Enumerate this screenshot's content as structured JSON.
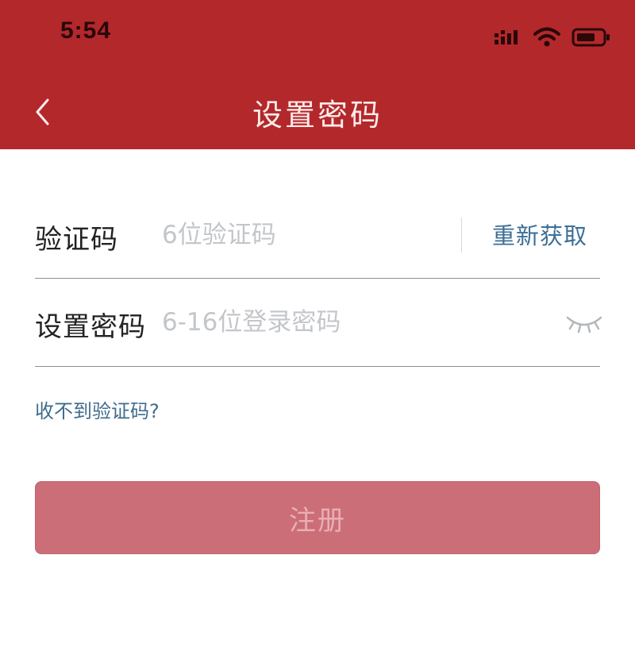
{
  "status_bar": {
    "time": "5:54",
    "icons": [
      "signal-icon",
      "wifi-icon",
      "battery-icon"
    ]
  },
  "nav": {
    "back_icon": "chevron-left-icon",
    "title": "设置密码"
  },
  "form": {
    "code": {
      "label": "验证码",
      "placeholder": "6位验证码",
      "value": "",
      "resend_label": "重新获取"
    },
    "password": {
      "label": "设置密码",
      "placeholder": "6-16位登录密码",
      "value": "",
      "visibility_icon": "eye-closed-icon"
    },
    "help_link": "收不到验证码?",
    "submit_label": "注册"
  },
  "colors": {
    "header_bg": "#b3282b",
    "button_bg": "#cb6e78",
    "link": "#3d6f96"
  }
}
